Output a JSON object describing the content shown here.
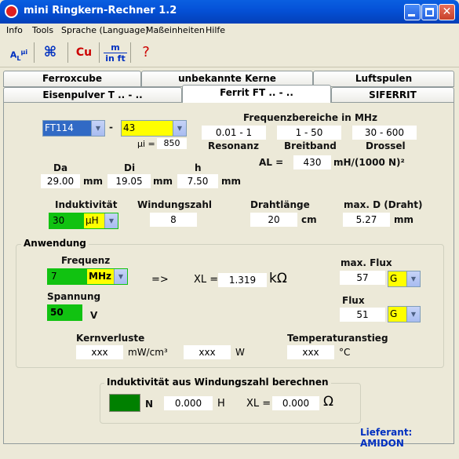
{
  "window": {
    "title": "mini Ringkern-Rechner 1.2"
  },
  "menu": [
    "Info",
    "Tools",
    "Sprache (Language)",
    "Maßeinheiten",
    "Hilfe"
  ],
  "toolbar": {
    "units_top": "m",
    "units_bottom": "in ft",
    "material": "Cu",
    "help": "?"
  },
  "tabs": {
    "ferroxcube": "Ferroxcube",
    "unbekannte": "unbekannte Kerne",
    "luftspulen": "Luftspulen",
    "eisenpulver": "Eisenpulver T .. - ..",
    "ferrit": "Ferrit FT .. - ..",
    "siferrit": "SIFERRIT"
  },
  "core": {
    "type": "FT114",
    "dash": "-",
    "material": "43",
    "mui_label": "µi =",
    "mui": "850"
  },
  "freq_ranges": {
    "title": "Frequenzbereiche in MHz",
    "resonanz": "0.01 - 1",
    "breitband": "1 - 50",
    "drossel": "30 - 600",
    "resonanz_label": "Resonanz",
    "breitband_label": "Breitband",
    "drossel_label": "Drossel"
  },
  "al": {
    "label": "AL =",
    "value": "430",
    "unit": "mH/(1000 N)²"
  },
  "dims": {
    "da_label": "Da",
    "di_label": "Di",
    "h_label": "h",
    "da": "29.00",
    "di": "19.05",
    "h": "7.50",
    "unit": "mm"
  },
  "inductance": {
    "label": "Induktivität",
    "value": "30",
    "unit": "µH"
  },
  "windings": {
    "label": "Windungszahl",
    "value": "8"
  },
  "wire": {
    "label": "Drahtlänge",
    "value": "20",
    "unit": "cm"
  },
  "maxd": {
    "label": "max. D (Draht)",
    "value": "5.27",
    "unit": "mm"
  },
  "application": {
    "title": "Anwendung",
    "freq_label": "Frequenz",
    "freq": "7",
    "freq_unit": "MHz",
    "arrow": "=>",
    "xl_label": "XL =",
    "xl": "1.319",
    "xl_unit": "kΩ",
    "voltage_label": "Spannung",
    "voltage": "50",
    "voltage_unit": "V",
    "maxflux_label": "max. Flux",
    "maxflux": "57",
    "maxflux_unit": "G",
    "flux_label": "Flux",
    "flux": "51",
    "flux_unit": "G",
    "coreloss_label": "Kernverluste",
    "coreloss": "xxx",
    "coreloss_unit": "mW/cm³",
    "loss_w": "xxx",
    "loss_w_unit": "W",
    "temp_label": "Temperaturanstieg",
    "temp": "xxx",
    "temp_unit": "°C"
  },
  "calc": {
    "title": "Induktivität aus Windungszahl berechnen",
    "n_label": "N",
    "inductance": "0.000",
    "inductance_unit": "H",
    "xl_label": "XL =",
    "xl": "0.000",
    "xl_unit": "Ω"
  },
  "supplier": "Lieferant: AMIDON"
}
